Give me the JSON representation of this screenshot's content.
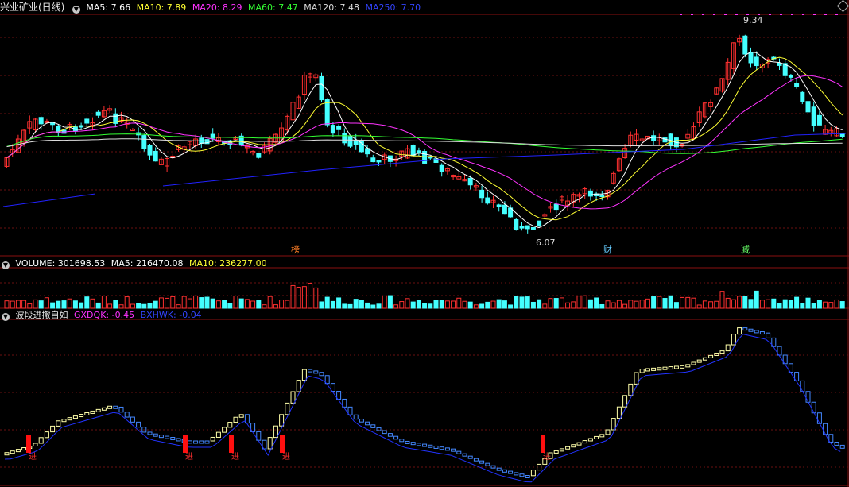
{
  "price_panel": {
    "title": "兴业矿业(日线)",
    "indicators": [
      {
        "label": "MA5: 7.66",
        "color": "#ffffff"
      },
      {
        "label": "MA10: 7.89",
        "color": "#ffff33"
      },
      {
        "label": "MA20: 8.29",
        "color": "#ff33ff"
      },
      {
        "label": "MA60: 7.47",
        "color": "#33ff33"
      },
      {
        "label": "MA120: 7.48",
        "color": "#dddddd"
      },
      {
        "label": "MA250: 7.70",
        "color": "#2222ff"
      }
    ],
    "high_label": "9.34",
    "low_label": "6.07",
    "markers": [
      {
        "text": "榜",
        "color": "#ff7f27"
      },
      {
        "text": "财",
        "color": "#66ccff"
      },
      {
        "text": "减",
        "color": "#66ff66"
      }
    ]
  },
  "volume_panel": {
    "label": "VOLUME: 301698.53",
    "ma5": "MA5: 216470.08",
    "ma10": "MA10: 236277.00",
    "colors": {
      "label": "#ffffff",
      "ma5": "#ffffff",
      "ma10": "#ffff33"
    }
  },
  "indicator_panel": {
    "name": "波段进撤自如",
    "gxdqk": "GXDQK: -0.45",
    "bxhwk": "BXHWK: -0.04",
    "buy_marker": "进",
    "colors": {
      "gxdqk": "#ff33ff",
      "bxhwk": "#3333ff"
    }
  },
  "palette": {
    "up": "#ff3030",
    "down": "#44ffff",
    "grid": "#6a1010"
  }
}
